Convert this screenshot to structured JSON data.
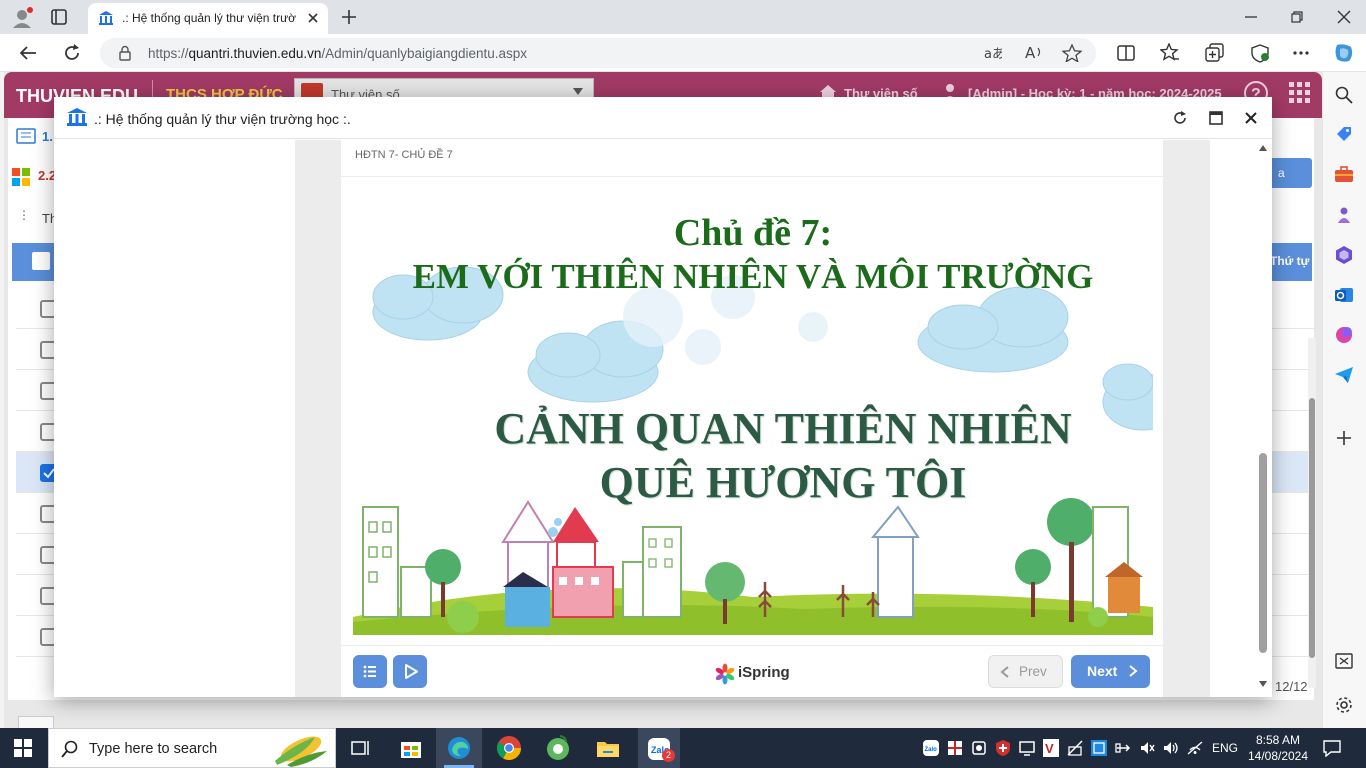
{
  "browser": {
    "tab_title": ".: Hệ thống quản lý thư viện trườ",
    "url_prefix": "https://",
    "url_host": "quantri.thuvien.edu.vn",
    "url_path": "/Admin/quanlybaigiangdientu.aspx"
  },
  "page": {
    "brand": "THUVIEN.EDU",
    "school": "THCS HỢP ĐỨC",
    "library_select": "Thư viện số",
    "library_link": "Thư viện số",
    "admin_info": "[Admin] - Học kỳ: 1 - năm học: 2024-2025",
    "menu_item_1": "1.",
    "menu_item_2": "2.2",
    "filter_label": "Th",
    "column_order": "Thứ tự",
    "add_button_partial": "a",
    "pagination": "12/12",
    "rows_checked": [
      false,
      false,
      false,
      false,
      true,
      false,
      false,
      false,
      false
    ]
  },
  "modal": {
    "title": ".: Hệ thống quản lý thư viện trường học :.",
    "slide_label": "HĐTN 7- CHỦ ĐỀ 7",
    "slide": {
      "line1": "Chủ đề 7:",
      "line2": "EM VỚI THIÊN NHIÊN VÀ MÔI TRƯỜNG",
      "line3": "CẢNH QUAN THIÊN NHIÊN",
      "line4": "QUÊ HƯƠNG TÔI"
    },
    "controls": {
      "brand": "iSpring",
      "prev": "Prev",
      "next": "Next"
    }
  },
  "taskbar": {
    "search_placeholder": "Type here to search",
    "language": "ENG",
    "time": "8:58 AM",
    "date": "14/08/2024",
    "zalo_badge": "2"
  },
  "colors": {
    "header_magenta": "#a23a66",
    "accent_blue": "#5b8fdb",
    "title_green": "#1b6b1b",
    "title_dark_green": "#2c5a45"
  }
}
